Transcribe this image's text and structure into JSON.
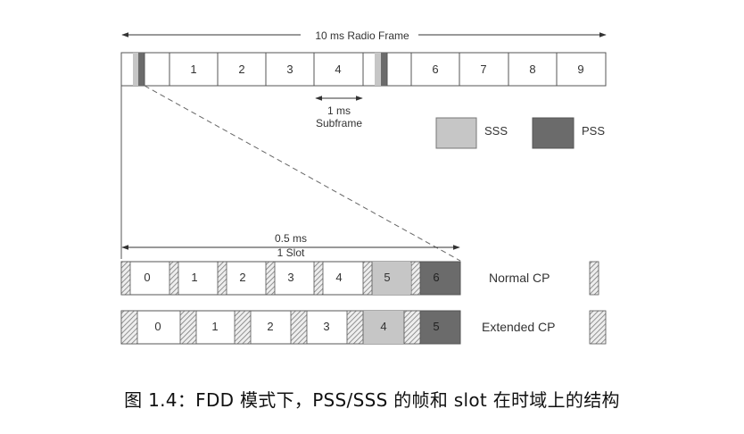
{
  "radio_frame": {
    "label": "10 ms Radio Frame",
    "subframes": [
      "",
      "",
      "1",
      "2",
      "3",
      "4",
      "",
      "",
      "6",
      "7",
      "8",
      "9"
    ]
  },
  "subframe_marker": {
    "line1": "1 ms",
    "line2": "Subframe"
  },
  "legend": {
    "sss_label": "SSS",
    "pss_label": "PSS",
    "sss_color": "#c6c6c6",
    "pss_color": "#6b6b6b"
  },
  "slot_marker": {
    "line1": "0.5 ms",
    "line2": "1 Slot"
  },
  "normal_cp": {
    "label": "Normal CP",
    "symbols": [
      "0",
      "1",
      "2",
      "3",
      "4",
      "5",
      "6"
    ]
  },
  "extended_cp": {
    "label": "Extended CP",
    "symbols": [
      "0",
      "1",
      "2",
      "3",
      "4",
      "5"
    ]
  },
  "caption": "图 1.4：FDD 模式下，PSS/SSS 的帧和 slot 在时域上的结构"
}
